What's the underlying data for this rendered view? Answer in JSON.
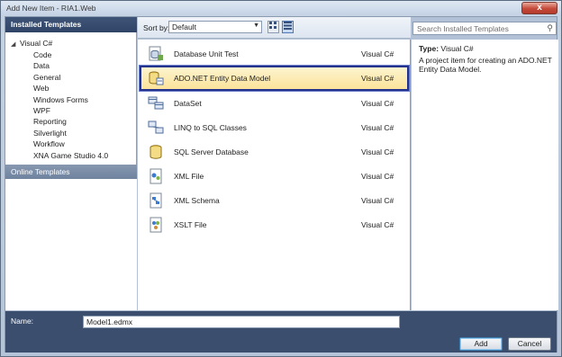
{
  "window": {
    "title": "Add New Item - RIA1.Web",
    "close_glyph": "x"
  },
  "left": {
    "header": "Installed Templates",
    "root": "Visual C#",
    "children": [
      "Code",
      "Data",
      "General",
      "Web",
      "Windows Forms",
      "WPF",
      "Reporting",
      "Silverlight",
      "Workflow",
      "XNA Game Studio 4.0"
    ],
    "online": "Online Templates"
  },
  "toolbar": {
    "sort_label": "Sort by:",
    "sort_value": "Default"
  },
  "search": {
    "placeholder": "Search Installed Templates"
  },
  "templates": [
    {
      "name": "Database Unit Test",
      "lang": "Visual C#",
      "icon": "database-unit-test-icon"
    },
    {
      "name": "ADO.NET Entity Data Model",
      "lang": "Visual C#",
      "icon": "entity-data-model-icon"
    },
    {
      "name": "DataSet",
      "lang": "Visual C#",
      "icon": "dataset-icon"
    },
    {
      "name": "LINQ to SQL Classes",
      "lang": "Visual C#",
      "icon": "linq-to-sql-icon"
    },
    {
      "name": "SQL Server Database",
      "lang": "Visual C#",
      "icon": "sql-database-icon"
    },
    {
      "name": "XML File",
      "lang": "Visual C#",
      "icon": "xml-file-icon"
    },
    {
      "name": "XML Schema",
      "lang": "Visual C#",
      "icon": "xml-schema-icon"
    },
    {
      "name": "XSLT File",
      "lang": "Visual C#",
      "icon": "xslt-file-icon"
    }
  ],
  "description": {
    "type_label": "Type:",
    "type_value": "Visual C#",
    "text": "A project item for creating an ADO.NET Entity Data Model."
  },
  "bottom": {
    "name_label": "Name:",
    "name_value": "Model1.edmx",
    "add_label": "Add",
    "cancel_label": "Cancel"
  },
  "colors": {
    "selection_border": "#23328a",
    "selection_fill": "#fbe39a",
    "header_fill": "#2f4466"
  }
}
